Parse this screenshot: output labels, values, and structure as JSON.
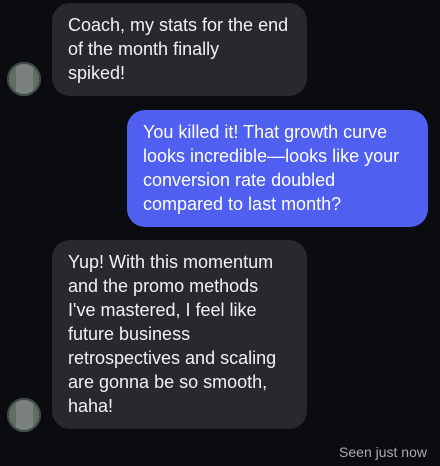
{
  "conversation": {
    "messages": [
      {
        "sender": "coach-contact",
        "direction": "incoming",
        "text": "Coach, my stats for the end\nof the month finally\nspiked!"
      },
      {
        "sender": "me",
        "direction": "outgoing",
        "text": "You killed it! That growth curve\nlooks incredible—looks like your\nconversion rate doubled\ncompared to last month?"
      },
      {
        "sender": "coach-contact",
        "direction": "incoming",
        "text": "Yup! With this momentum\nand the promo methods\nI've mastered, I feel like\nfuture business\nretrospectives and scaling\nare gonna be so smooth,\nhaha!"
      }
    ],
    "status": "Seen just now"
  },
  "colors": {
    "background": "#0b0c0f",
    "incoming_bubble": "#27292e",
    "outgoing_bubble": "#4f5ff0",
    "status_text": "#a8abb1"
  },
  "icons": {
    "avatar": "contact-avatar"
  }
}
